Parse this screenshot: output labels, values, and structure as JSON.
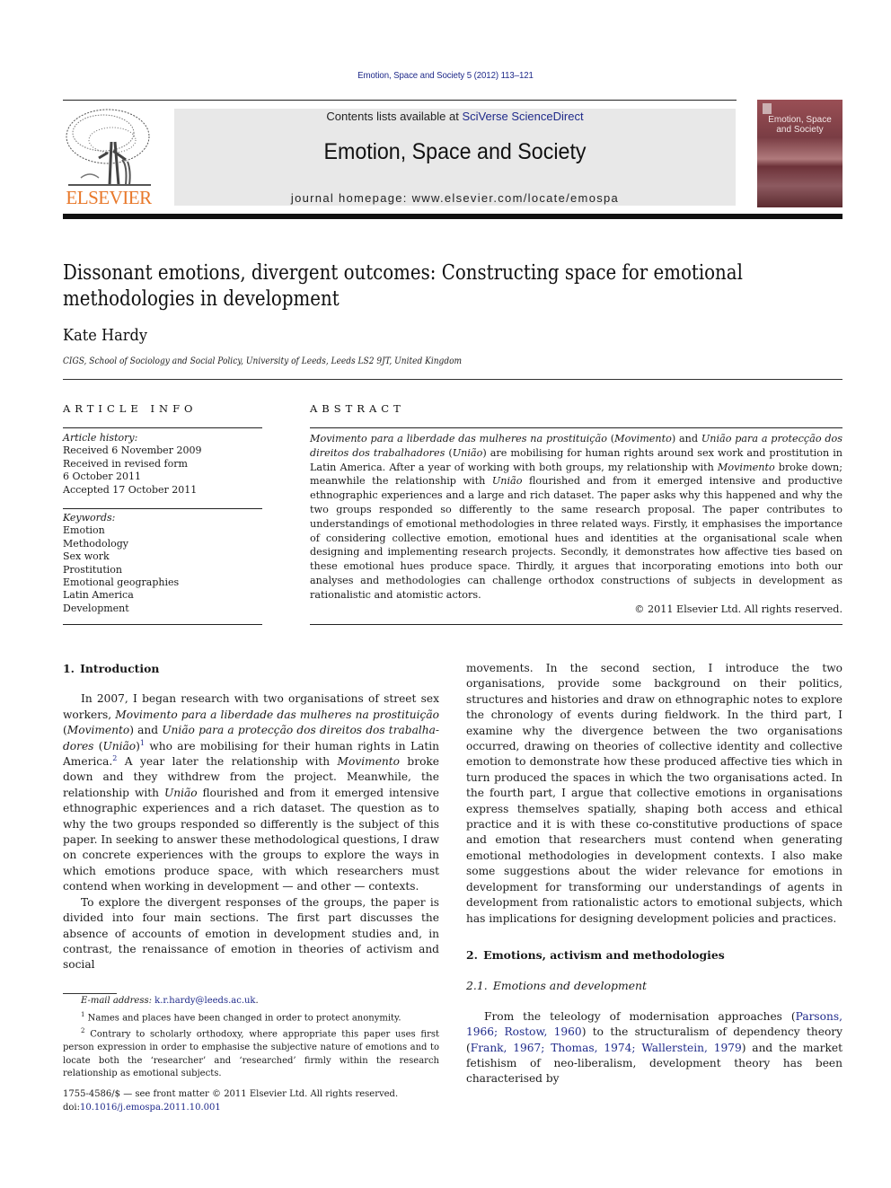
{
  "running_header": "Emotion, Space and Society 5 (2012) 113–121",
  "publisher": {
    "logo_word": "ELSEVIER",
    "logo_color": "#e8782a"
  },
  "banner": {
    "contents_prefix": "Contents lists available at ",
    "contents_link": "SciVerse ScienceDirect",
    "journal_title": "Emotion, Space and Society",
    "homepage_prefix": "journal homepage: ",
    "homepage_url": "www.elsevier.com/locate/emospa"
  },
  "cover": {
    "title_line1": "Emotion, Space",
    "title_line2": "and Society"
  },
  "article": {
    "title": "Dissonant emotions, divergent outcomes: Constructing space for emotional methodologies in development",
    "author": "Kate Hardy",
    "affiliation": "CIGS, School of Sociology and Social Policy, University of Leeds, Leeds LS2 9JT, United Kingdom"
  },
  "article_info": {
    "heading": "ARTICLE INFO",
    "history_label": "Article history:",
    "history": [
      "Received 6 November 2009",
      "Received in revised form",
      "6 October 2011",
      "Accepted 17 October 2011"
    ],
    "keywords_label": "Keywords:",
    "keywords": [
      "Emotion",
      "Methodology",
      "Sex work",
      "Prostitution",
      "Emotional geographies",
      "Latin America",
      "Development"
    ]
  },
  "abstract": {
    "heading": "ABSTRACT",
    "seg1_i": "Movimento para a liberdade das mulheres na prostituição",
    "seg2": " (",
    "seg3_i": "Movimento",
    "seg4": ") and ",
    "seg5_i": "União para a protecção dos direitos dos trabalhadores",
    "seg6": " (",
    "seg7_i": "União",
    "seg8": ") are mobilising for human rights around sex work and prostitution in Latin America. After a year of working with both groups, my relationship with ",
    "seg9_i": "Movimento",
    "seg10": " broke down; meanwhile the relationship with ",
    "seg11_i": "União",
    "seg12": " flourished and from it emerged intensive and productive ethnographic experiences and a large and rich dataset. The paper asks why this happened and why the two groups responded so differently to the same research proposal. The paper contributes to understandings of emotional methodologies in three related ways. Firstly, it emphasises the importance of considering collective emotion, emotional hues and identities at the organisational scale when designing and implementing research projects. Secondly, it demonstrates how affective ties based on these emotional hues produce space. Thirdly, it argues that incorporating emotions into both our analyses and methodologies can challenge orthodox constructions of subjects in development as rationalistic and atomistic actors.",
    "copyright": "© 2011 Elsevier Ltd. All rights reserved."
  },
  "body": {
    "sec1_heading": "1. Introduction",
    "p1": {
      "a": "In 2007, I began research with two organisations of street sex workers, ",
      "b_i": "Movimento para a liberdade das mulheres na prostituição",
      "c": " (",
      "d_i": "Movimento",
      "e": ") and ",
      "f_i": "União para a protecção dos direitos dos trabalha-dores",
      "g": " (",
      "h_i": "União",
      "i": ")",
      "fn1": "1",
      "j": " who are mobilising for their human rights in Latin America.",
      "fn2": "2",
      "k": " A year later the relationship with ",
      "l_i": "Movimento",
      "m": " broke down and they withdrew from the project. Meanwhile, the relationship with ",
      "n_i": "União",
      "o": " flourished and from it emerged intensive ethnographic experiences and a rich dataset. The question as to why the two groups responded so differently is the subject of this paper. In seeking to answer these methodological questions, I draw on concrete experiences with the groups to explore the ways in which emotions produce space, with which researchers must contend when working in development — and other — contexts."
    },
    "p2": "To explore the divergent responses of the groups, the paper is divided into four main sections. The first part discusses the absence of accounts of emotion in development studies and, in contrast, the renaissance of emotion in theories of activism and social",
    "p2_cont": "movements. In the second section, I introduce the two organisations, provide some background on their politics, structures and histories and draw on ethnographic notes to explore the chronology of events during fieldwork. In the third part, I examine why the divergence between the two organisations occurred, drawing on theories of collective identity and collective emotion to demonstrate how these produced affective ties which in turn produced the spaces in which the two organisations acted. In the fourth part, I argue that collective emotions in organisations express themselves spatially, shaping both access and ethical practice and it is with these co-constitutive productions of space and emotion that researchers must contend when generating emotional methodologies in development contexts. I also make some suggestions about the wider relevance for emotions in development for transforming our understandings of agents in development from rationalistic actors to emotional subjects, which has implications for designing development policies and practices.",
    "sec2_heading": "2. Emotions, activism and methodologies",
    "sec21_heading": "2.1. Emotions and development",
    "p3": {
      "a": "From the teleology of modernisation approaches (",
      "c1": "Parsons, 1966",
      "s1": "; ",
      "c2": "Rostow, 1960",
      "b": ") to the structuralism of dependency theory (",
      "c3": "Frank, 1967",
      "s2": "; ",
      "c4": "Thomas, 1974",
      "s3": "; ",
      "c5": "Wallerstein, 1979",
      "d": ") and the market fetishism of neo-liberalism, development theory has been characterised by"
    }
  },
  "footnotes": {
    "email_label": "E-mail address: ",
    "email": "k.r.hardy@leeds.ac.uk",
    "email_end": ".",
    "fn1_num": "1",
    "fn1": " Names and places have been changed in order to protect anonymity.",
    "fn2_num": "2",
    "fn2": " Contrary to scholarly orthodoxy, where appropriate this paper uses first person expression in order to emphasise the subjective nature of emotions and to locate both the ‘researcher’ and ‘researched’ firmly within the research relationship as emotional subjects."
  },
  "front_matter": {
    "issn_line": "1755-4586/$ — see front matter © 2011 Elsevier Ltd. All rights reserved.",
    "doi_label": "doi:",
    "doi": "10.1016/j.emospa.2011.10.001"
  },
  "colors": {
    "link": "#1f2a8a",
    "banner_bg": "#e8e8e8",
    "cover": "#8a4a50"
  }
}
